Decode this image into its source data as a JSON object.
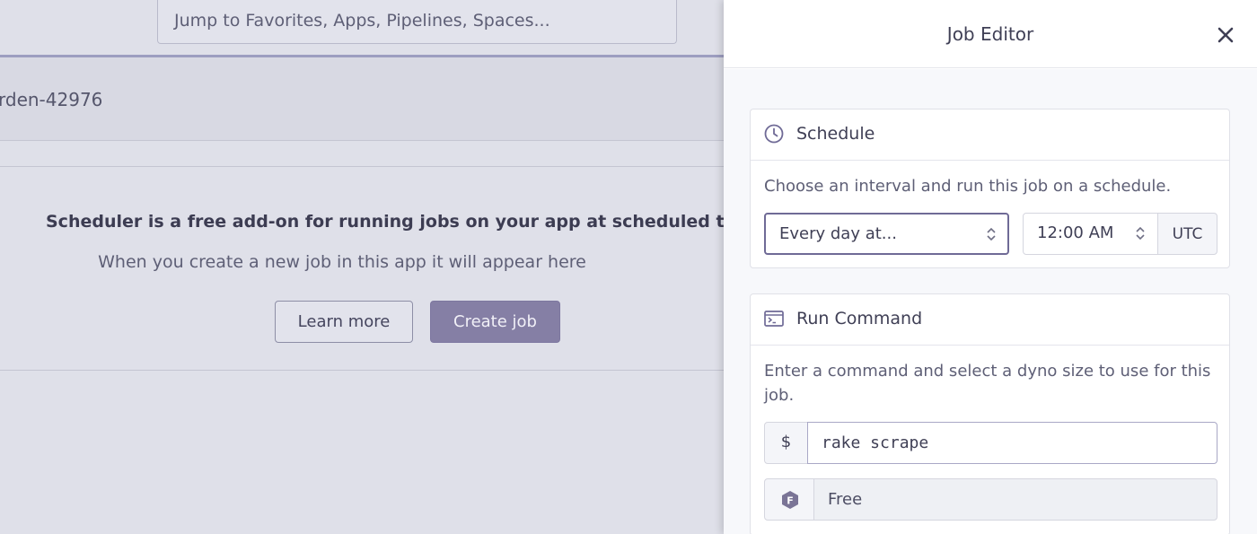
{
  "search": {
    "placeholder": "Jump to Favorites, Apps, Pipelines, Spaces..."
  },
  "app": {
    "name_fragment": "rden-42976"
  },
  "empty_state": {
    "headline": "Scheduler is a free add-on for running jobs on your app at scheduled time in",
    "subtext": "When you create a new job in this app it will appear here",
    "learn_more_label": "Learn more",
    "create_job_label": "Create job"
  },
  "drawer": {
    "title": "Job Editor",
    "close_icon": "close-icon"
  },
  "schedule": {
    "title": "Schedule",
    "icon": "clock-icon",
    "description": "Choose an interval and run this job on a schedule.",
    "interval_value": "Every day at...",
    "time_value": "12:00 AM",
    "timezone": "UTC"
  },
  "run_command": {
    "title": "Run Command",
    "icon": "terminal-icon",
    "description": "Enter a command and select a dyno size to use for this job.",
    "prefix": "$",
    "command_value": "rake scrape",
    "dyno_badge_letter": "F",
    "dyno_size": "Free"
  },
  "colors": {
    "accent": "#79589f",
    "overlay_bg": "#dfe0e9",
    "text": "#3f3f55"
  }
}
